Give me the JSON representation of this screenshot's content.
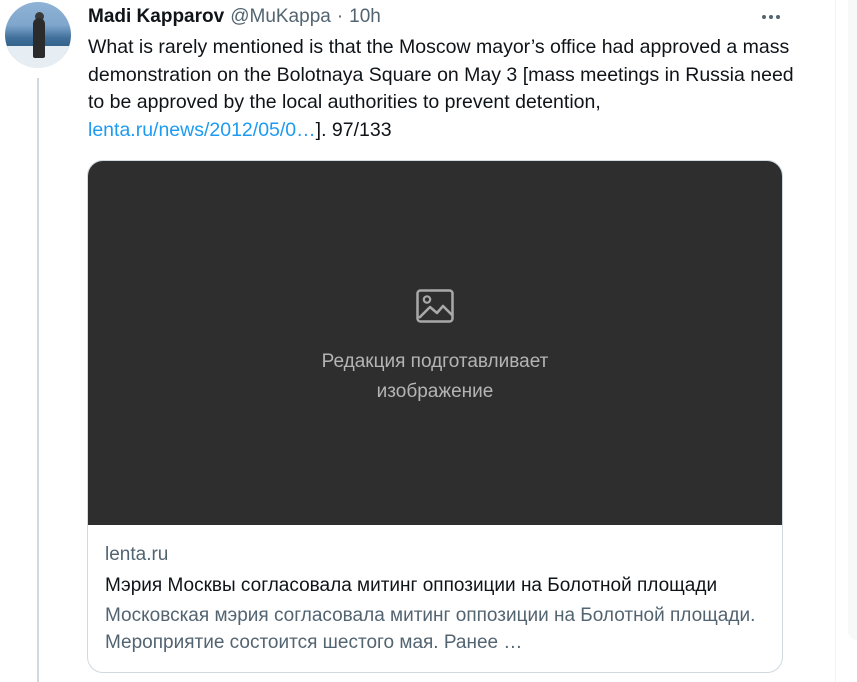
{
  "tweet": {
    "author_name": "Madi Kapparov",
    "handle": "@MuKappa",
    "separator": "·",
    "time": "10h",
    "text_before_link": "What is rarely mentioned is that the Moscow mayor’s office had approved a mass demonstration on the Bolotnaya Square on May 3 [mass meetings in Russia need to be approved by the local authorities to prevent detention, ",
    "link_text": "lenta.ru/news/2012/05/0…",
    "text_after_link": "]. 97/133"
  },
  "card": {
    "placeholder_line1": "Редакция подготавливает",
    "placeholder_line2": "изображение",
    "domain": "lenta.ru",
    "title": "Мэрия Москвы согласовала митинг оппозиции на Болотной площади",
    "description": "Московская мэрия согласовала митинг оппозиции на Болотной площади. Мероприятие состоится шестого мая. Ранее …",
    "placeholder_icon": "image-icon"
  },
  "icons": {
    "more": "more-options-icon"
  },
  "colors": {
    "link": "#1d9bf0",
    "secondary_text": "#536471",
    "media_background": "#2e2e2e"
  }
}
